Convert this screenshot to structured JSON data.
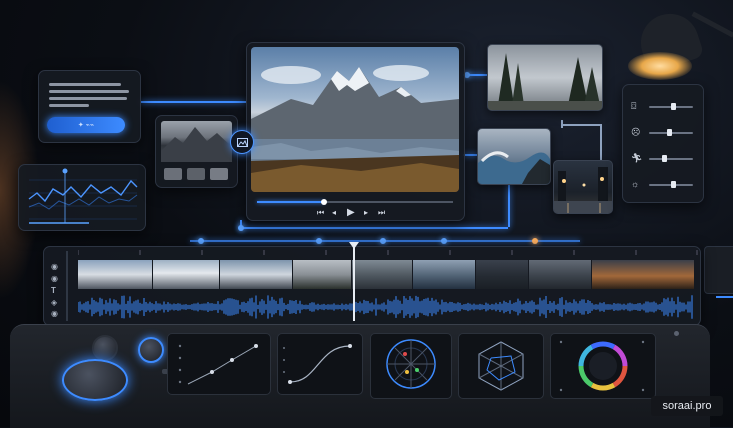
{
  "watermark": "soraai.pro",
  "colors": {
    "accent": "#3d8bff",
    "lamp": "#ffd08a"
  },
  "icons": {
    "generate": "sparkle-icon",
    "image": "image-icon",
    "camera": "camera-icon",
    "face": "face-icon",
    "motion": "running-person-icon",
    "light": "sun-icon",
    "eye": "eye-icon",
    "text": "text-icon"
  },
  "player": {
    "progress": 0.34
  },
  "adjustments": [
    {
      "icon": "camera-icon",
      "value": 0.55
    },
    {
      "icon": "face-icon",
      "value": 0.45
    },
    {
      "icon": "running-person-icon",
      "value": 0.35
    },
    {
      "icon": "sun-icon",
      "value": 0.55
    }
  ],
  "timeline": {
    "playhead": 0.45
  }
}
